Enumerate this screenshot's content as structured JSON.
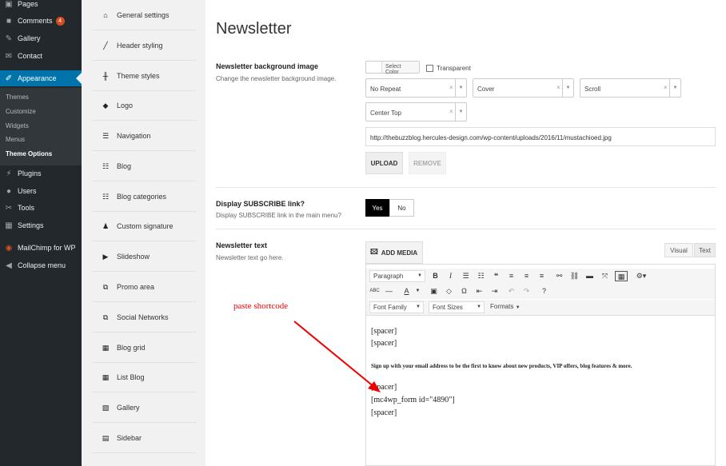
{
  "admin_menu": {
    "items": [
      {
        "label": "Pages",
        "icon": "pages-icon"
      },
      {
        "label": "Comments",
        "icon": "comments-icon",
        "badge": "4"
      },
      {
        "label": "Gallery",
        "icon": "gallery-pin-icon"
      },
      {
        "label": "Contact",
        "icon": "mail-icon"
      },
      {
        "label": "Appearance",
        "icon": "paintbrush-icon"
      }
    ],
    "submenu": [
      "Themes",
      "Customize",
      "Widgets",
      "Menus",
      "Theme Options"
    ],
    "items_after": [
      {
        "label": "Plugins",
        "icon": "plugin-icon"
      },
      {
        "label": "Users",
        "icon": "users-icon"
      },
      {
        "label": "Tools",
        "icon": "wrench-icon"
      },
      {
        "label": "Settings",
        "icon": "settings-icon"
      },
      {
        "label": "MailChimp for WP",
        "icon": "mailchimp-icon"
      },
      {
        "label": "Collapse menu",
        "icon": "collapse-icon"
      }
    ]
  },
  "options_nav": [
    {
      "label": "General settings",
      "icon": "home-icon"
    },
    {
      "label": "Header styling",
      "icon": "pencil-icon"
    },
    {
      "label": "Theme styles",
      "icon": "sliders-icon"
    },
    {
      "label": "Logo",
      "icon": "tag-icon"
    },
    {
      "label": "Navigation",
      "icon": "menu-icon"
    },
    {
      "label": "Blog",
      "icon": "list-icon"
    },
    {
      "label": "Blog categories",
      "icon": "list-bullets-icon"
    },
    {
      "label": "Custom signature",
      "icon": "user-icon"
    },
    {
      "label": "Slideshow",
      "icon": "play-icon"
    },
    {
      "label": "Promo area",
      "icon": "external-icon"
    },
    {
      "label": "Social Networks",
      "icon": "external-icon"
    },
    {
      "label": "Blog grid",
      "icon": "grid-icon"
    },
    {
      "label": "List Blog",
      "icon": "grid-icon"
    },
    {
      "label": "Gallery",
      "icon": "image-icon"
    },
    {
      "label": "Sidebar",
      "icon": "sidebar-icon"
    }
  ],
  "main": {
    "title": "Newsletter",
    "bg_image": {
      "title": "Newsletter background image",
      "desc": "Change the newsletter background image.",
      "select_color": "Select Color",
      "transparent": "Transparent",
      "repeat": "No Repeat",
      "size": "Cover",
      "attachment": "Scroll",
      "position": "Center Top",
      "url": "http://thebuzzblog.hercules-design.com/wp-content/uploads/2016/11/mustachioed.jpg",
      "upload": "UPLOAD",
      "remove": "REMOVE"
    },
    "subscribe": {
      "title": "Display SUBSCRIBE link?",
      "desc": "Display SUBSCRIBE link in the main menu?",
      "yes": "Yes",
      "no": "No"
    },
    "newsletter_text": {
      "title": "Newsletter text",
      "desc": "Newsletter text go here.",
      "add_media": "ADD MEDIA",
      "tab_visual": "Visual",
      "tab_text": "Text",
      "paragraph": "Paragraph",
      "font_family": "Font Family",
      "font_sizes": "Font Sizes",
      "formats": "Formats",
      "content": [
        "[spacer]",
        "[spacer]",
        "Sign up with your email address to be the first to know about new products, VIP offers, blog features & more.",
        "[spacer]",
        "[mc4wp_form id=\"4890\"]",
        "[spacer]"
      ]
    }
  },
  "annotation": "paste shortcode",
  "colors": {
    "admin_bg": "#23282d",
    "admin_active": "#0073aa",
    "annotation": "#ee0000"
  }
}
